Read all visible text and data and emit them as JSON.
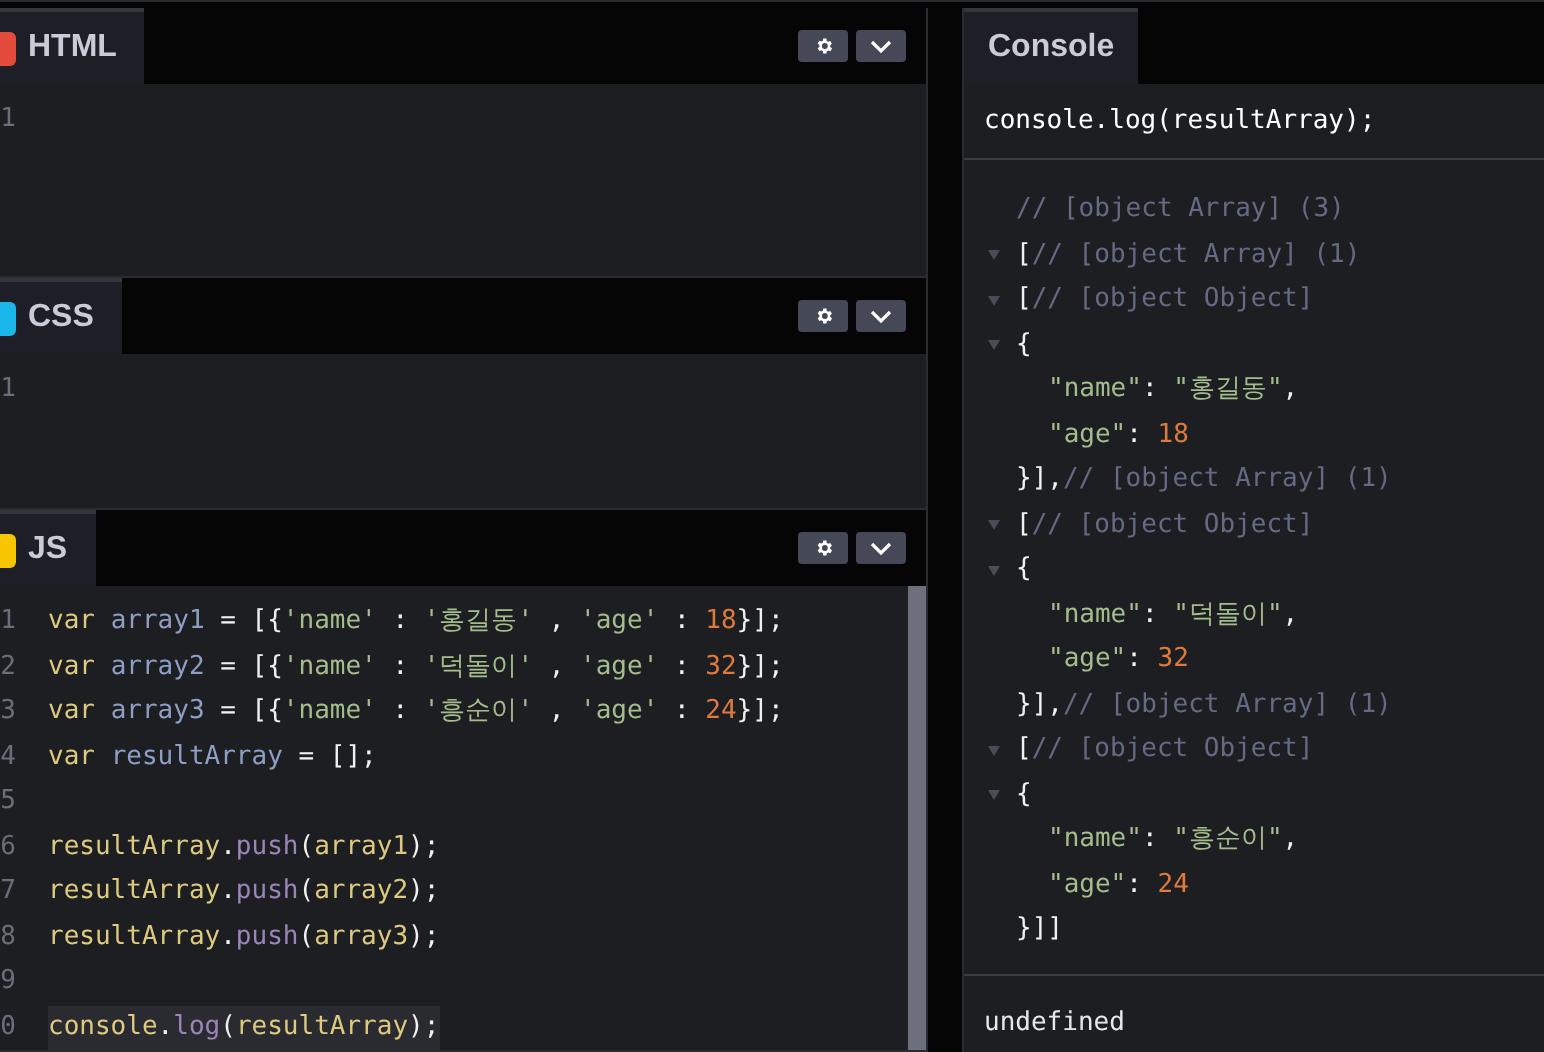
{
  "editors": [
    {
      "kind": "html",
      "title": "HTML",
      "line_numbers": [
        "1"
      ]
    },
    {
      "kind": "css",
      "title": "CSS",
      "line_numbers": [
        "1"
      ]
    },
    {
      "kind": "js",
      "title": "JS",
      "line_numbers": [
        "1",
        "2",
        "3",
        "4",
        "5",
        "6",
        "7",
        "8",
        "9",
        "0"
      ],
      "lines": [
        {
          "highlighted": false,
          "tokens": [
            {
              "kind": "keyword",
              "text": "var "
            },
            {
              "kind": "variable",
              "text": "array1"
            },
            {
              "kind": "punct",
              "text": " = [{"
            },
            {
              "kind": "string",
              "text": "'name'"
            },
            {
              "kind": "punct",
              "text": " : "
            },
            {
              "kind": "string",
              "text": "'홍길동'"
            },
            {
              "kind": "punct",
              "text": " , "
            },
            {
              "kind": "string",
              "text": "'age'"
            },
            {
              "kind": "punct",
              "text": " : "
            },
            {
              "kind": "number",
              "text": "18"
            },
            {
              "kind": "punct",
              "text": "}];"
            }
          ]
        },
        {
          "highlighted": false,
          "tokens": [
            {
              "kind": "keyword",
              "text": "var "
            },
            {
              "kind": "variable",
              "text": "array2"
            },
            {
              "kind": "punct",
              "text": " = [{"
            },
            {
              "kind": "string",
              "text": "'name'"
            },
            {
              "kind": "punct",
              "text": " : "
            },
            {
              "kind": "string",
              "text": "'덕돌이'"
            },
            {
              "kind": "punct",
              "text": " , "
            },
            {
              "kind": "string",
              "text": "'age'"
            },
            {
              "kind": "punct",
              "text": " : "
            },
            {
              "kind": "number",
              "text": "32"
            },
            {
              "kind": "punct",
              "text": "}];"
            }
          ]
        },
        {
          "highlighted": false,
          "tokens": [
            {
              "kind": "keyword",
              "text": "var "
            },
            {
              "kind": "variable",
              "text": "array3"
            },
            {
              "kind": "punct",
              "text": " = [{"
            },
            {
              "kind": "string",
              "text": "'name'"
            },
            {
              "kind": "punct",
              "text": " : "
            },
            {
              "kind": "string",
              "text": "'흥순이'"
            },
            {
              "kind": "punct",
              "text": " , "
            },
            {
              "kind": "string",
              "text": "'age'"
            },
            {
              "kind": "punct",
              "text": " : "
            },
            {
              "kind": "number",
              "text": "24"
            },
            {
              "kind": "punct",
              "text": "}];"
            }
          ]
        },
        {
          "highlighted": false,
          "tokens": [
            {
              "kind": "keyword",
              "text": "var "
            },
            {
              "kind": "variable",
              "text": "resultArray"
            },
            {
              "kind": "punct",
              "text": " = [];"
            }
          ]
        },
        {
          "highlighted": false
        },
        {
          "highlighted": false,
          "tokens": [
            {
              "kind": "keyword",
              "text": "resultArray"
            },
            {
              "kind": "punct",
              "text": "."
            },
            {
              "kind": "method",
              "text": "push"
            },
            {
              "kind": "punct",
              "text": "("
            },
            {
              "kind": "keyword",
              "text": "array1"
            },
            {
              "kind": "punct",
              "text": ");"
            }
          ]
        },
        {
          "highlighted": false,
          "tokens": [
            {
              "kind": "keyword",
              "text": "resultArray"
            },
            {
              "kind": "punct",
              "text": "."
            },
            {
              "kind": "method",
              "text": "push"
            },
            {
              "kind": "punct",
              "text": "("
            },
            {
              "kind": "keyword",
              "text": "array2"
            },
            {
              "kind": "punct",
              "text": ");"
            }
          ]
        },
        {
          "highlighted": false,
          "tokens": [
            {
              "kind": "keyword",
              "text": "resultArray"
            },
            {
              "kind": "punct",
              "text": "."
            },
            {
              "kind": "method",
              "text": "push"
            },
            {
              "kind": "punct",
              "text": "("
            },
            {
              "kind": "keyword",
              "text": "array3"
            },
            {
              "kind": "punct",
              "text": ");"
            }
          ]
        },
        {
          "highlighted": false
        },
        {
          "highlighted": true,
          "tokens": [
            {
              "kind": "keyword",
              "text": "console"
            },
            {
              "kind": "punct",
              "text": "."
            },
            {
              "kind": "method",
              "text": "log"
            },
            {
              "kind": "punct",
              "text": "("
            },
            {
              "kind": "keyword",
              "text": "resultArray"
            },
            {
              "kind": "punct",
              "text": ");"
            }
          ]
        }
      ]
    }
  ],
  "console": {
    "title": "Console",
    "command": "console.log(resultArray);",
    "lines": [
      {
        "kind": "header",
        "toggle": false,
        "tokens": [
          {
            "kind": "comment",
            "text": "// [object Array] (3)"
          }
        ]
      },
      {
        "kind": "node",
        "toggle": true,
        "tokens": [
          {
            "kind": "punct",
            "text": "["
          },
          {
            "kind": "comment",
            "text": "// [object Array] (1)"
          }
        ]
      },
      {
        "kind": "node",
        "toggle": true,
        "tokens": [
          {
            "kind": "punct",
            "text": "["
          },
          {
            "kind": "comment",
            "text": "// [object Object]"
          }
        ]
      },
      {
        "kind": "node",
        "toggle": true,
        "tokens": [
          {
            "kind": "punct",
            "text": "{"
          }
        ]
      },
      {
        "kind": "prop",
        "toggle": false,
        "tokens": [
          {
            "kind": "string",
            "text": "\"name\""
          },
          {
            "kind": "punct",
            "text": ": "
          },
          {
            "kind": "string",
            "text": "\"홍길동\""
          },
          {
            "kind": "punct",
            "text": ","
          }
        ]
      },
      {
        "kind": "prop",
        "toggle": false,
        "tokens": [
          {
            "kind": "string",
            "text": "\"age\""
          },
          {
            "kind": "punct",
            "text": ": "
          },
          {
            "kind": "number",
            "text": "18"
          }
        ]
      },
      {
        "kind": "close",
        "toggle": false,
        "tokens": [
          {
            "kind": "punct",
            "text": "}],"
          },
          {
            "kind": "comment",
            "text": "// [object Array] (1)"
          }
        ]
      },
      {
        "kind": "node",
        "toggle": true,
        "tokens": [
          {
            "kind": "punct",
            "text": "["
          },
          {
            "kind": "comment",
            "text": "// [object Object]"
          }
        ]
      },
      {
        "kind": "node",
        "toggle": true,
        "tokens": [
          {
            "kind": "punct",
            "text": "{"
          }
        ]
      },
      {
        "kind": "prop",
        "toggle": false,
        "tokens": [
          {
            "kind": "string",
            "text": "\"name\""
          },
          {
            "kind": "punct",
            "text": ": "
          },
          {
            "kind": "string",
            "text": "\"덕돌이\""
          },
          {
            "kind": "punct",
            "text": ","
          }
        ]
      },
      {
        "kind": "prop",
        "toggle": false,
        "tokens": [
          {
            "kind": "string",
            "text": "\"age\""
          },
          {
            "kind": "punct",
            "text": ": "
          },
          {
            "kind": "number",
            "text": "32"
          }
        ]
      },
      {
        "kind": "close",
        "toggle": false,
        "tokens": [
          {
            "kind": "punct",
            "text": "}],"
          },
          {
            "kind": "comment",
            "text": "// [object Array] (1)"
          }
        ]
      },
      {
        "kind": "node",
        "toggle": true,
        "tokens": [
          {
            "kind": "punct",
            "text": "["
          },
          {
            "kind": "comment",
            "text": "// [object Object]"
          }
        ]
      },
      {
        "kind": "node",
        "toggle": true,
        "tokens": [
          {
            "kind": "punct",
            "text": "{"
          }
        ]
      },
      {
        "kind": "prop",
        "toggle": false,
        "tokens": [
          {
            "kind": "string",
            "text": "\"name\""
          },
          {
            "kind": "punct",
            "text": ": "
          },
          {
            "kind": "string",
            "text": "\"흥순이\""
          },
          {
            "kind": "punct",
            "text": ","
          }
        ]
      },
      {
        "kind": "prop",
        "toggle": false,
        "tokens": [
          {
            "kind": "string",
            "text": "\"age\""
          },
          {
            "kind": "punct",
            "text": ": "
          },
          {
            "kind": "number",
            "text": "24"
          }
        ]
      },
      {
        "kind": "close",
        "toggle": false,
        "tokens": [
          {
            "kind": "punct",
            "text": "}]]"
          }
        ]
      }
    ],
    "result": "undefined"
  }
}
